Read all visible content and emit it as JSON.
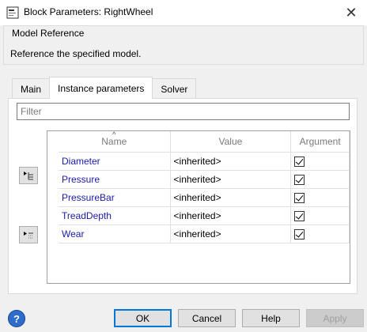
{
  "window": {
    "title": "Block Parameters: RightWheel",
    "close_glyph": "✕"
  },
  "group": {
    "legend": "Model Reference",
    "description": "Reference the specified model."
  },
  "tabs": [
    {
      "label": "Main",
      "active": false
    },
    {
      "label": "Instance parameters",
      "active": true
    },
    {
      "label": "Solver",
      "active": false
    }
  ],
  "filter": {
    "placeholder": "Filter",
    "value": ""
  },
  "table": {
    "columns": {
      "name": "Name",
      "value": "Value",
      "argument": "Argument"
    },
    "sort_glyph": "^",
    "rows": [
      {
        "name": "Diameter",
        "value": "<inherited>",
        "argument": true
      },
      {
        "name": "Pressure",
        "value": "<inherited>",
        "argument": true
      },
      {
        "name": "PressureBar",
        "value": "<inherited>",
        "argument": true
      },
      {
        "name": "TreadDepth",
        "value": "<inherited>",
        "argument": true
      },
      {
        "name": "Wear",
        "value": "<inherited>",
        "argument": true
      }
    ]
  },
  "buttons": {
    "ok": "OK",
    "cancel": "Cancel",
    "help": "Help",
    "apply": "Apply"
  },
  "icons": {
    "app": "simulink-block-icon",
    "help": "help-question-icon",
    "help_glyph": "?",
    "side_top": "expand-tree-icon",
    "side_bottom": "collapse-tree-icon"
  },
  "colors": {
    "param_name": "#1a1ab3",
    "help_icon": "#2f6bc8",
    "default_button_border": "#0078d7"
  }
}
